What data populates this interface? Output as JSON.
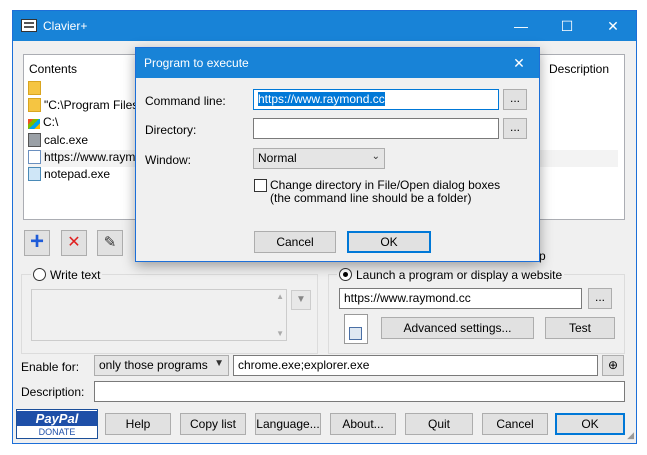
{
  "window": {
    "title": "Clavier+",
    "minimize": "—",
    "maximize": "☐",
    "close": "✕"
  },
  "list": {
    "col_contents": "Contents",
    "col_description": "Description",
    "items": [
      {
        "label": "",
        "icon": "folder-icon"
      },
      {
        "label": "\"C:\\Program Files\"",
        "icon": "folder-icon"
      },
      {
        "label": "C:\\",
        "icon": "drive-icon"
      },
      {
        "label": "calc.exe",
        "icon": "calculator-icon"
      },
      {
        "label": "https://www.raym",
        "icon": "document-icon"
      },
      {
        "label": "notepad.exe",
        "icon": "notepad-icon"
      }
    ],
    "trailing_letter": "p"
  },
  "toolbar": {
    "add": "+",
    "delete": "✕",
    "edit": "✎"
  },
  "write_text": {
    "label": "Write text",
    "value": ""
  },
  "launch": {
    "label": "Launch a program or display a website",
    "value": "https://www.raymond.cc",
    "browse": "...",
    "advanced": "Advanced settings...",
    "test": "Test"
  },
  "enable_for": {
    "label": "Enable for:",
    "mode": "only those programs",
    "programs": "chrome.exe;explorer.exe"
  },
  "description": {
    "label": "Description:",
    "value": ""
  },
  "bottom": {
    "paypal": "PayPal",
    "donate": "DONATE",
    "help": "Help",
    "copy_list": "Copy list",
    "language": "Language...",
    "about": "About...",
    "quit": "Quit",
    "cancel": "Cancel",
    "ok": "OK"
  },
  "dialog": {
    "title": "Program to execute",
    "close": "✕",
    "command_label": "Command line:",
    "command_value": "https://www.raymond.cc",
    "directory_label": "Directory:",
    "directory_value": "",
    "window_label": "Window:",
    "window_value": "Normal",
    "browse": "...",
    "chk_line1": "Change directory in File/Open dialog boxes",
    "chk_line2": "(the command line should be a folder)",
    "cancel": "Cancel",
    "ok": "OK"
  },
  "colors": {
    "titlebar": "#1883d7",
    "accent": "#0078d7",
    "add_icon": "#1e5bd8",
    "delete_icon": "#e02020"
  }
}
